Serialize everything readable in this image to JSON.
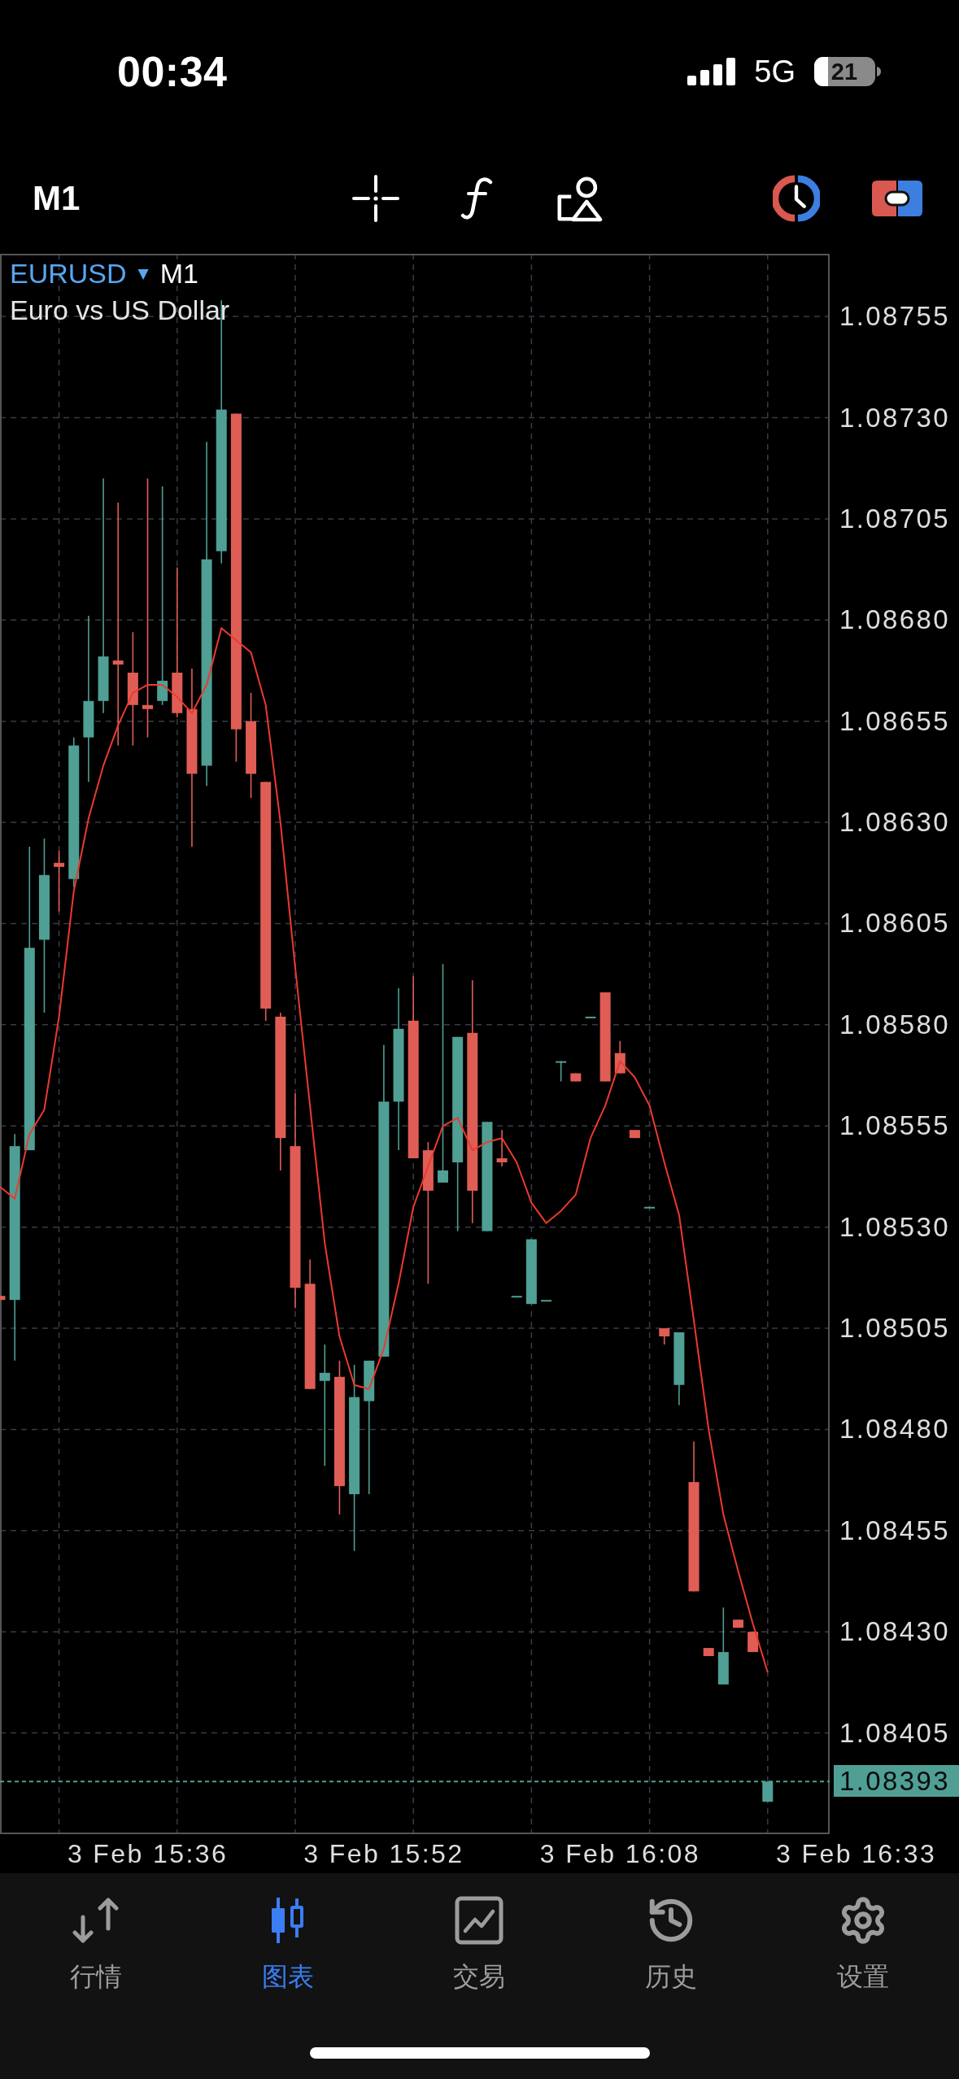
{
  "status_bar": {
    "time": "00:34",
    "network": "5G",
    "battery": "21"
  },
  "toolbar": {
    "timeframe": "M1"
  },
  "chart": {
    "symbol": "EURUSD",
    "symbol_menu": "▼",
    "timeframe": "M1",
    "description": "Euro vs US Dollar",
    "chart_data": {
      "type": "candlestick",
      "grid": true,
      "ylim": [
        1.0838,
        1.087705
      ],
      "categories": [
        null,
        null,
        null,
        null,
        null,
        null,
        null,
        null,
        null,
        null,
        "3 Feb 15:36",
        null,
        null,
        null,
        null,
        null,
        null,
        null,
        null,
        null,
        null,
        null,
        null,
        null,
        null,
        null,
        "3 Feb 15:52",
        null,
        null,
        null,
        null,
        null,
        null,
        null,
        null,
        null,
        null,
        null,
        null,
        null,
        null,
        null,
        "3 Feb 16:08",
        null,
        null,
        null,
        null,
        null,
        null,
        null,
        null,
        null,
        null,
        null,
        null,
        null,
        null,
        null,
        "3 Feb 16:33"
      ],
      "yticks": [
        {
          "value": 1.08755,
          "label": "1.08755"
        },
        {
          "value": 1.0873,
          "label": "1.08730"
        },
        {
          "value": 1.08705,
          "label": "1.08705"
        },
        {
          "value": 1.0868,
          "label": "1.08680"
        },
        {
          "value": 1.08655,
          "label": "1.08655"
        },
        {
          "value": 1.0863,
          "label": "1.08630"
        },
        {
          "value": 1.08605,
          "label": "1.08605"
        },
        {
          "value": 1.0858,
          "label": "1.08580"
        },
        {
          "value": 1.08555,
          "label": "1.08555"
        },
        {
          "value": 1.0853,
          "label": "1.08530"
        },
        {
          "value": 1.08505,
          "label": "1.08505"
        },
        {
          "value": 1.0848,
          "label": "1.08480"
        },
        {
          "value": 1.08455,
          "label": "1.08455"
        },
        {
          "value": 1.0843,
          "label": "1.08430"
        },
        {
          "value": 1.08405,
          "label": "1.08405"
        }
      ],
      "ohlc": [
        [
          1.08513,
          1.08513,
          1.08512,
          1.08512
        ],
        [
          1.08512,
          1.08553,
          1.08497,
          1.0855
        ],
        [
          1.08549,
          1.08624,
          1.08549,
          1.08599
        ],
        [
          1.08601,
          1.08626,
          1.08583,
          1.08617
        ],
        [
          1.0862,
          1.08623,
          1.08608,
          1.08619
        ],
        [
          1.08616,
          1.08651,
          1.08614,
          1.08649
        ],
        [
          1.08651,
          1.08681,
          1.0864,
          1.0866
        ],
        [
          1.0866,
          1.08715,
          1.08657,
          1.08671
        ],
        [
          1.0867,
          1.08709,
          1.08649,
          1.08669
        ],
        [
          1.08667,
          1.08677,
          1.08649,
          1.08659
        ],
        [
          1.08659,
          1.08715,
          1.08651,
          1.08658
        ],
        [
          1.0866,
          1.08713,
          1.08659,
          1.08665
        ],
        [
          1.08667,
          1.08693,
          1.08656,
          1.08657
        ],
        [
          1.08658,
          1.08668,
          1.08624,
          1.08642
        ],
        [
          1.08644,
          1.08724,
          1.08639,
          1.08695
        ],
        [
          1.08697,
          1.08759,
          1.08694,
          1.08732
        ],
        [
          1.08731,
          1.08731,
          1.08645,
          1.08653
        ],
        [
          1.08655,
          1.08662,
          1.08636,
          1.08642
        ],
        [
          1.0864,
          1.0864,
          1.08581,
          1.08584
        ],
        [
          1.08582,
          1.08583,
          1.08544,
          1.08552
        ],
        [
          1.0855,
          1.08563,
          1.0851,
          1.08515
        ],
        [
          1.08516,
          1.08522,
          1.0849,
          1.0849
        ],
        [
          1.08492,
          1.08501,
          1.08471,
          1.08494
        ],
        [
          1.08493,
          1.08497,
          1.08459,
          1.08466
        ],
        [
          1.08464,
          1.08496,
          1.0845,
          1.08488
        ],
        [
          1.08487,
          1.08497,
          1.08464,
          1.08497
        ],
        [
          1.08498,
          1.08575,
          1.08498,
          1.08561
        ],
        [
          1.08561,
          1.08589,
          1.08549,
          1.08579
        ],
        [
          1.08581,
          1.08592,
          1.08547,
          1.08547
        ],
        [
          1.08549,
          1.08551,
          1.08516,
          1.08539
        ],
        [
          1.08541,
          1.08595,
          1.08541,
          1.08544
        ],
        [
          1.08546,
          1.08577,
          1.08529,
          1.08577
        ],
        [
          1.08578,
          1.08591,
          1.08531,
          1.08539
        ],
        [
          1.08529,
          1.08556,
          1.08529,
          1.08556
        ],
        [
          1.08547,
          1.08554,
          1.08545,
          1.08546
        ],
        [
          1.08513,
          1.08513,
          1.08513,
          1.08513
        ],
        [
          1.08511,
          1.08527,
          1.08511,
          1.08527
        ],
        [
          1.08512,
          1.08512,
          1.08512,
          1.08512
        ],
        [
          1.08571,
          1.08571,
          1.08566,
          1.08571
        ],
        [
          1.08568,
          1.08568,
          1.08566,
          1.08566
        ],
        [
          1.08582,
          1.08582,
          1.08582,
          1.08582
        ],
        [
          1.08588,
          1.08588,
          1.08566,
          1.08566
        ],
        [
          1.08573,
          1.08576,
          1.08568,
          1.08568
        ],
        [
          1.08554,
          1.08554,
          1.08552,
          1.08552
        ],
        [
          1.08535,
          1.08535,
          1.08535,
          1.08535
        ],
        [
          1.08505,
          1.08505,
          1.08501,
          1.08503
        ],
        [
          1.08491,
          1.08504,
          1.08486,
          1.08504
        ],
        [
          1.08467,
          1.08477,
          1.0844,
          1.0844
        ],
        [
          1.08426,
          1.08426,
          1.08424,
          1.08424
        ],
        [
          1.08417,
          1.08436,
          1.08417,
          1.08425
        ],
        [
          1.08433,
          1.08433,
          1.08431,
          1.08431
        ],
        [
          1.0843,
          1.0843,
          1.08425,
          1.08425
        ],
        [
          1.08388,
          1.08393,
          1.08388,
          1.08393
        ],
        null,
        null,
        null,
        null,
        null,
        null
      ],
      "series": [
        {
          "type": "line",
          "color": "#ec3a2e",
          "values": [
            1.0854,
            1.08537,
            1.08553,
            1.08559,
            1.08582,
            1.08613,
            1.08631,
            1.08644,
            1.08654,
            1.08662,
            1.08664,
            1.08664,
            1.08661,
            1.08657,
            1.08664,
            1.08678,
            1.08675,
            1.08672,
            1.08659,
            1.0863,
            1.08594,
            1.0856,
            1.08526,
            1.08503,
            1.08491,
            1.0849,
            1.085,
            1.08516,
            1.08535,
            1.08545,
            1.08555,
            1.08557,
            1.08549,
            1.08551,
            1.08552,
            1.08546,
            1.08536,
            1.08531,
            1.08534,
            1.08538,
            1.08552,
            1.0856,
            1.08571,
            1.08567,
            1.0856,
            1.08546,
            1.08533,
            1.08507,
            1.0848,
            1.08459,
            1.08445,
            1.08432,
            1.0842,
            null,
            null,
            null,
            null,
            null,
            null
          ]
        }
      ],
      "ref_lines": [
        {
          "axis": "y",
          "value": 1.08393,
          "label": "1.08393"
        }
      ]
    }
  },
  "tab_bar": {
    "tabs": [
      {
        "kind": "quotes",
        "label": "行情",
        "selected": false
      },
      {
        "kind": "chart",
        "label": "图表",
        "selected": true
      },
      {
        "kind": "trade",
        "label": "交易",
        "selected": false
      },
      {
        "kind": "history",
        "label": "历史",
        "selected": false
      },
      {
        "kind": "settings",
        "label": "设置",
        "selected": false
      }
    ]
  }
}
